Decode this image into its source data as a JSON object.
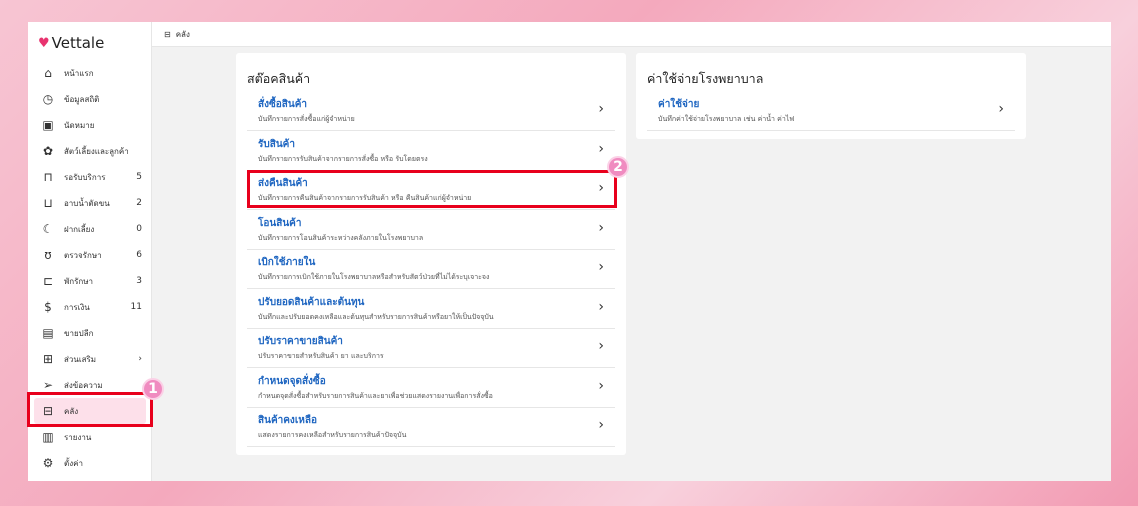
{
  "app": {
    "logo": "Vettale",
    "breadcrumb": "คลัง"
  },
  "sidebar": {
    "items": [
      {
        "label": "หน้าแรก",
        "icon": "home-icon",
        "glyph": "⌂",
        "count": ""
      },
      {
        "label": "ข้อมูลสถิติ",
        "icon": "dashboard-icon",
        "glyph": "◷",
        "count": ""
      },
      {
        "label": "นัดหมาย",
        "icon": "calendar-icon",
        "glyph": "▣",
        "count": ""
      },
      {
        "label": "สัตว์เลี้ยงและลูกค้า",
        "icon": "paw-icon",
        "glyph": "✿",
        "count": ""
      },
      {
        "label": "รอรับบริการ",
        "icon": "sofa-icon",
        "glyph": "⊓",
        "count": "5"
      },
      {
        "label": "อาบน้ำตัดขน",
        "icon": "bathtub-icon",
        "glyph": "⊔",
        "count": "2"
      },
      {
        "label": "ฝากเลี้ยง",
        "icon": "moon-icon",
        "glyph": "☾",
        "count": "0"
      },
      {
        "label": "ตรวจรักษา",
        "icon": "stethoscope-icon",
        "glyph": "ʊ",
        "count": "6"
      },
      {
        "label": "พักรักษา",
        "icon": "bed-icon",
        "glyph": "⊏",
        "count": "3"
      },
      {
        "label": "การเงิน",
        "icon": "money-hand-icon",
        "glyph": "$",
        "count": "11"
      },
      {
        "label": "ขายปลีก",
        "icon": "cash-register-icon",
        "glyph": "▤",
        "count": ""
      },
      {
        "label": "ส่วนเสริม",
        "icon": "plus-box-icon",
        "glyph": "⊞",
        "count": "›"
      },
      {
        "label": "ส่งข้อความ",
        "icon": "paper-plane-icon",
        "glyph": "➢",
        "count": ""
      },
      {
        "label": "คลัง",
        "icon": "archive-icon",
        "glyph": "⊟",
        "count": ""
      },
      {
        "label": "รายงาน",
        "icon": "bar-chart-icon",
        "glyph": "▥",
        "count": ""
      },
      {
        "label": "ตั้งค่า",
        "icon": "gear-icon",
        "glyph": "⚙",
        "count": ""
      }
    ]
  },
  "stock": {
    "title": "สต๊อคสินค้า",
    "items": [
      {
        "title": "สั่งซื้อสินค้า",
        "desc": "บันทึกรายการสั่งซื้อแก่ผู้จำหน่าย"
      },
      {
        "title": "รับสินค้า",
        "desc": "บันทึกรายการรับสินค้าจากรายการสั่งซื้อ หรือ รับโดยตรง"
      },
      {
        "title": "ส่งคืนสินค้า",
        "desc": "บันทึกรายการคืนสินค้าจากรายการรับสินค้า หรือ คืนสินค้าแก่ผู้จำหน่าย"
      },
      {
        "title": "โอนสินค้า",
        "desc": "บันทึกรายการโอนสินค้าระหว่างคลังภายในโรงพยาบาล"
      },
      {
        "title": "เบิกใช้ภายใน",
        "desc": "บันทึกรายการเบิกใช้ภายในโรงพยาบาลหรือสำหรับสัตว์ป่วยที่ไม่ได้ระบุเจาะจง"
      },
      {
        "title": "ปรับยอดสินค้าและต้นทุน",
        "desc": "บันทึกและปรับยอดคงเหลือและต้นทุนสำหรับรายการสินค้าหรือยาให้เป็นปัจจุบัน"
      },
      {
        "title": "ปรับราคาขายสินค้า",
        "desc": "ปรับราคาขายสำหรับสินค้า ยา และบริการ"
      },
      {
        "title": "กำหนดจุดสั่งซื้อ",
        "desc": "กำหนดจุดสั่งซื้อสำหรับรายการสินค้าและยาเพื่อช่วยแสดงรายงานเพื่อการสั่งซื้อ"
      },
      {
        "title": "สินค้าคงเหลือ",
        "desc": "แสดงรายการคงเหลือสำหรับรายการสินค้าปัจจุบัน"
      }
    ]
  },
  "expense": {
    "title": "ค่าใช้จ่ายโรงพยาบาล",
    "items": [
      {
        "title": "ค่าใช้จ่าย",
        "desc": "บันทึกค่าใช้จ่ายโรงพยาบาล เช่น ค่าน้ำ ค่าไฟ"
      }
    ]
  },
  "annotations": {
    "step1": "1",
    "step2": "2"
  }
}
